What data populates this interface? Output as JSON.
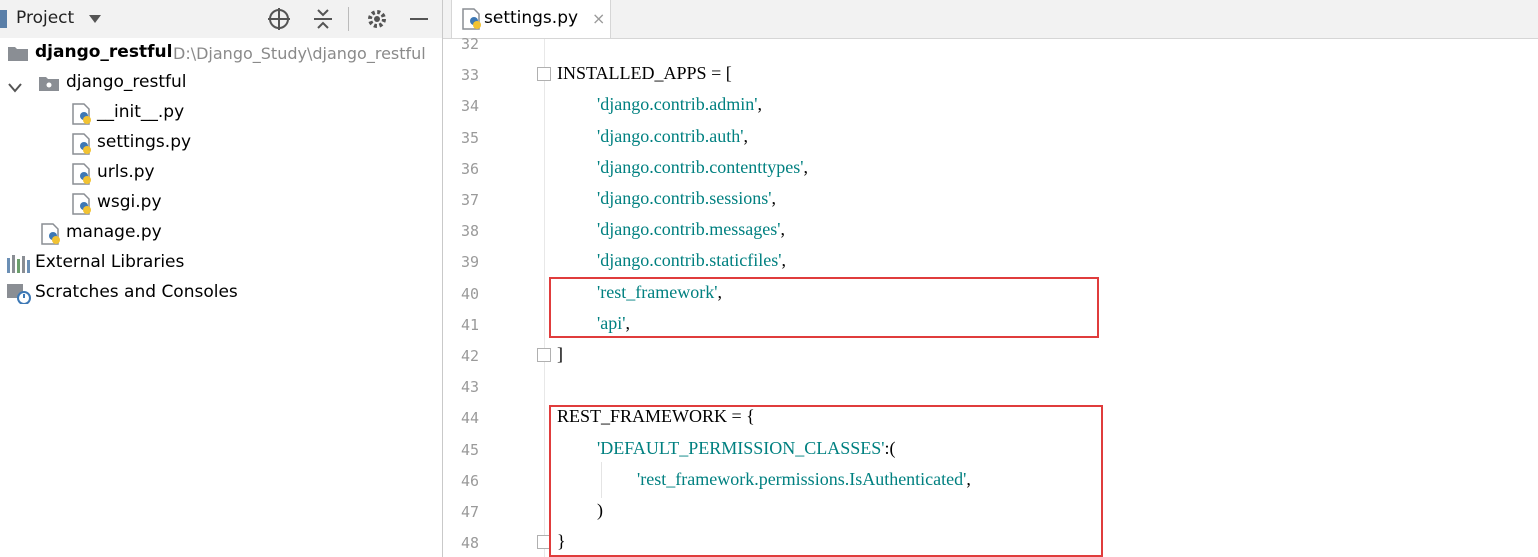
{
  "project_panel": {
    "title": "Project",
    "toolbar": {
      "locate_icon": "crosshair-icon",
      "collapse_icon": "collapse-all-icon",
      "settings_icon": "gear-icon",
      "hide_icon": "minimize-icon"
    },
    "tree": [
      {
        "label": "django_restful",
        "sub": "D:\\Django_Study\\django_restful",
        "icon": "folder-icon",
        "level": 0
      },
      {
        "label": "django_restful",
        "icon": "package-folder-icon",
        "level": 1,
        "expanded": true
      },
      {
        "label": "__init__.py",
        "icon": "python-file-icon",
        "level": 2
      },
      {
        "label": "settings.py",
        "icon": "python-file-icon",
        "level": 2
      },
      {
        "label": "urls.py",
        "icon": "python-file-icon",
        "level": 2
      },
      {
        "label": "wsgi.py",
        "icon": "python-file-icon",
        "level": 2
      },
      {
        "label": "manage.py",
        "icon": "python-file-icon",
        "level": 1
      },
      {
        "label": "External Libraries",
        "icon": "libraries-icon",
        "level": 0
      },
      {
        "label": "Scratches and Consoles",
        "icon": "scratches-icon",
        "level": 0
      }
    ]
  },
  "editor": {
    "tab": {
      "label": "settings.py",
      "close": "×"
    },
    "lines": [
      {
        "n": "32",
        "code": ""
      },
      {
        "n": "33",
        "code": "INSTALLED_APPS = ["
      },
      {
        "n": "34",
        "str": "'django.contrib.admin'",
        "tail": ","
      },
      {
        "n": "35",
        "str": "'django.contrib.auth'",
        "tail": ","
      },
      {
        "n": "36",
        "str": "'django.contrib.contenttypes'",
        "tail": ","
      },
      {
        "n": "37",
        "str": "'django.contrib.sessions'",
        "tail": ","
      },
      {
        "n": "38",
        "str": "'django.contrib.messages'",
        "tail": ","
      },
      {
        "n": "39",
        "str": "'django.contrib.staticfiles'",
        "tail": ","
      },
      {
        "n": "40",
        "str": "'rest_framework'",
        "tail": ","
      },
      {
        "n": "41",
        "str": "'api'",
        "tail": ","
      },
      {
        "n": "42",
        "code": "]"
      },
      {
        "n": "43",
        "code": ""
      },
      {
        "n": "44",
        "code": "REST_FRAMEWORK = {"
      },
      {
        "n": "45",
        "str": "'DEFAULT_PERMISSION_CLASSES'",
        "tail": ":("
      },
      {
        "n": "46",
        "str": "'rest_framework.permissions.IsAuthenticated'",
        "tail": ","
      },
      {
        "n": "47",
        "code": ")"
      },
      {
        "n": "48",
        "code": "}"
      }
    ]
  },
  "colors": {
    "string": "#008080",
    "highlight_box": "#e03c3c"
  }
}
